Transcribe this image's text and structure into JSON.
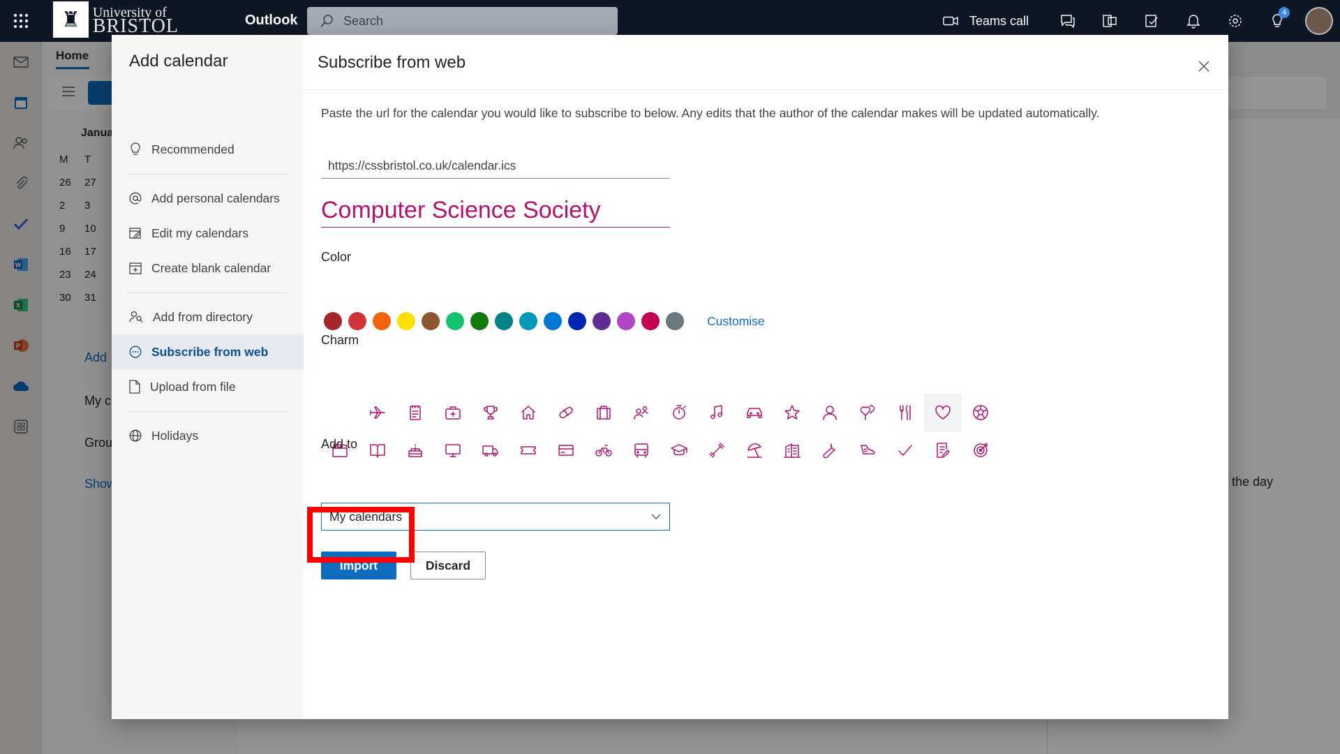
{
  "topbar": {
    "logo_line1": "University of",
    "logo_line2": "BRISTOL",
    "app_name": "Outlook",
    "search_placeholder": "Search",
    "teams_call": "Teams call",
    "notification_badge": "4",
    "bg_color": "#0f1724"
  },
  "background": {
    "home_tab": "Home",
    "month_label": "Janua",
    "weekday_headers": [
      "M",
      "T"
    ],
    "mini_dates": [
      "26",
      "27",
      "2",
      "3",
      "9",
      "10",
      "16",
      "17",
      "23",
      "24",
      "30",
      "31"
    ],
    "add_label": "Add",
    "my_label": "My c",
    "groups_label": "Grou",
    "show_label": "Show",
    "day_text": "the day"
  },
  "dialog": {
    "title": "Add calendar",
    "nav": [
      {
        "label": "Recommended",
        "icon": "lightbulb-icon"
      },
      {
        "label": "Add personal calendars",
        "icon": "at-icon"
      },
      {
        "label": "Edit my calendars",
        "icon": "edit-calendar-icon"
      },
      {
        "label": "Create blank calendar",
        "icon": "calendar-add-icon"
      },
      {
        "label": "Add from directory",
        "icon": "people-search-icon"
      },
      {
        "label": "Subscribe from web",
        "icon": "more-circle-icon",
        "active": true
      },
      {
        "label": "Upload from file",
        "icon": "document-icon"
      },
      {
        "label": "Holidays",
        "icon": "globe-icon"
      }
    ],
    "pane_title": "Subscribe from web",
    "description": "Paste the url for the calendar you would like to subscribe to below. Any edits that the author of the calendar makes will be updated automatically.",
    "url_value": "https://cssbristol.co.uk/calendar.ics",
    "calendar_name": "Computer Science Society",
    "color_label": "Color",
    "colors": [
      "#a4262c",
      "#d13438",
      "#f7630c",
      "#fce100",
      "#8e562e",
      "#13c26d",
      "#107c10",
      "#038387",
      "#0099bc",
      "#0078d4",
      "#0027b4",
      "#5c2e91",
      "#b146c2",
      "#c30052",
      "#69797e"
    ],
    "customise_label": "Customise",
    "charm_label": "Charm",
    "charms_row1": [
      "airplane-icon",
      "notepad-icon",
      "medical-bag-icon",
      "trophy-icon",
      "home-icon",
      "pill-icon",
      "briefcase-icon",
      "people-icon",
      "timer-icon",
      "music-note-icon",
      "car-icon",
      "star-icon",
      "person-icon",
      "balloon-icon",
      "cutlery-icon",
      "heart-icon",
      "soccer-ball-icon"
    ],
    "charms_row2": [
      "clapperboard-icon",
      "book-icon",
      "cake-icon",
      "monitor-icon",
      "truck-icon",
      "ticket-icon",
      "credit-card-icon",
      "bicycle-icon",
      "bus-icon",
      "graduation-cap-icon",
      "dumbbell-icon",
      "beach-icon",
      "building-icon",
      "wrench-icon",
      "running-shoe-icon",
      "checkmark-icon",
      "task-list-icon",
      "target-icon"
    ],
    "add_to_label": "Add to",
    "add_to_value": "My calendars",
    "import_label": "Import",
    "discard_label": "Discard",
    "accent_color": "#b4126e",
    "brand_color": "#0f6cbd"
  }
}
